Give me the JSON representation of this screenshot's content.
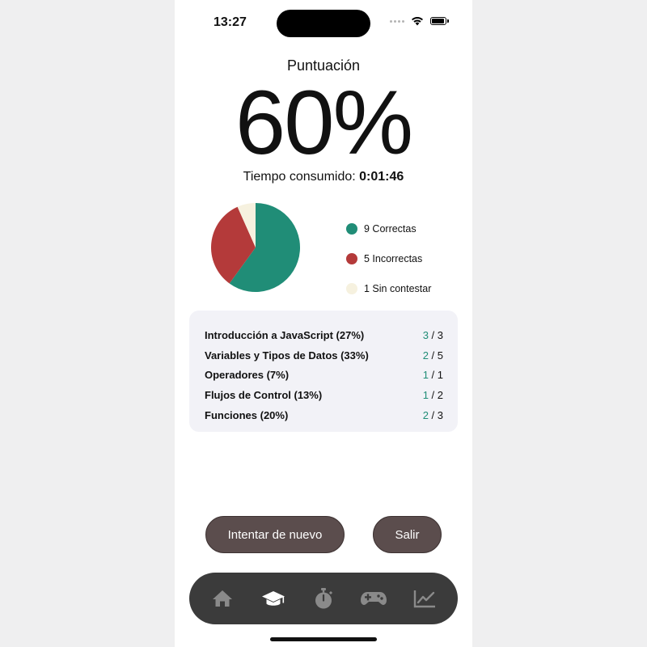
{
  "status_bar": {
    "time": "13:27"
  },
  "results": {
    "score_label": "Puntuación",
    "score_value": "60%",
    "time_label": "Tiempo consumido:",
    "time_value": "0:01:46"
  },
  "chart_data": {
    "type": "pie",
    "values": [
      9,
      5,
      1
    ],
    "colors": [
      "#208d77",
      "#b43a3a",
      "#f6f1df"
    ],
    "legend": [
      "9 Correctas",
      "5 Incorrectas",
      "1 Sin contestar"
    ],
    "legend_placement": "right"
  },
  "breakdown": [
    {
      "topic": "Introducción a JavaScript (27%)",
      "correct": "3",
      "total": "3"
    },
    {
      "topic": "Variables y Tipos de Datos (33%)",
      "correct": "2",
      "total": "5"
    },
    {
      "topic": "Operadores (7%)",
      "correct": "1",
      "total": "1"
    },
    {
      "topic": "Flujos de Control (13%)",
      "correct": "1",
      "total": "2"
    },
    {
      "topic": "Funciones (20%)",
      "correct": "2",
      "total": "3"
    }
  ],
  "buttons": {
    "retry": "Intentar de nuevo",
    "exit": "Salir"
  },
  "tabs": [
    {
      "icon": "home-icon",
      "active": false
    },
    {
      "icon": "graduation-cap-icon",
      "active": true
    },
    {
      "icon": "stopwatch-icon",
      "active": false
    },
    {
      "icon": "gamepad-icon",
      "active": false
    },
    {
      "icon": "chart-line-icon",
      "active": false
    }
  ],
  "colors": {
    "accent": "#208d77",
    "button": "#5b4d4d",
    "tabbar": "#3b3b3b",
    "card": "#f2f2f7"
  }
}
